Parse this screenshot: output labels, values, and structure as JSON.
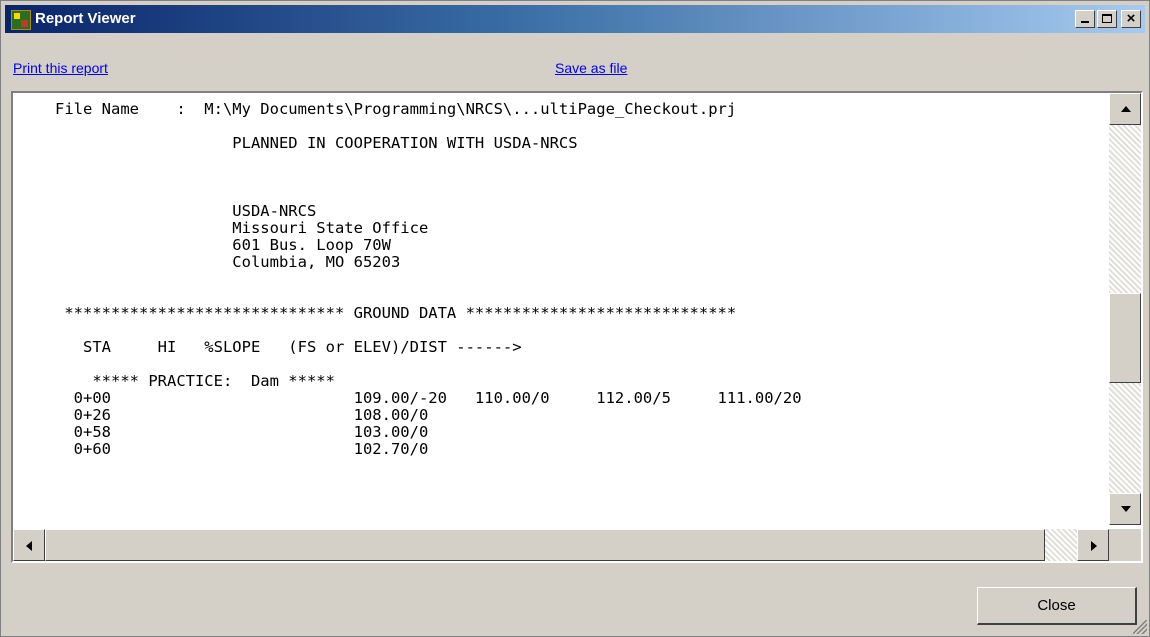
{
  "window": {
    "title": "Report Viewer",
    "icon": "app-icon"
  },
  "links": {
    "print": "Print this report",
    "save": "Save as file"
  },
  "report": {
    "lines": [
      "File Name    :  M:\\My Documents\\Programming\\NRCS\\...ultiPage_Checkout.prj",
      "",
      "                   PLANNED IN COOPERATION WITH USDA-NRCS",
      "",
      "",
      "",
      "                   USDA-NRCS",
      "                   Missouri State Office",
      "                   601 Bus. Loop 70W",
      "                   Columbia, MO 65203",
      "",
      "",
      " ****************************** GROUND DATA *****************************",
      "",
      "   STA     HI   %SLOPE   (FS or ELEV)/DIST ------>",
      "",
      "    ***** PRACTICE:  Dam *****",
      "  0+00                          109.00/-20   110.00/0     112.00/5     111.00/20",
      "  0+26                          108.00/0",
      "  0+58                          103.00/0",
      "  0+60                          102.70/0"
    ]
  },
  "buttons": {
    "close": "Close"
  },
  "colors": {
    "titlebar_start": "#0a246a",
    "titlebar_end": "#a6caf0",
    "link": "#0000ee",
    "face": "#d4d0c8"
  }
}
